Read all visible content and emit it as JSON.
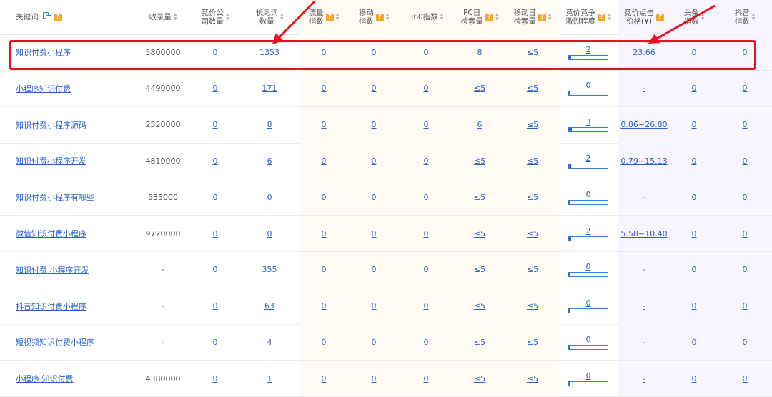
{
  "headers": {
    "keyword": "关键词",
    "index_volume": "收录量",
    "bid_companies": [
      "竞价公",
      "司数量"
    ],
    "long_tail": [
      "长尾词",
      "数量"
    ],
    "traffic_index": [
      "流量",
      "指数"
    ],
    "mobile_index": [
      "移动",
      "指数"
    ],
    "index_360": "360指数",
    "pc_daily": [
      "PC日",
      "检索量"
    ],
    "mobile_daily": [
      "移动日",
      "检索量"
    ],
    "bid_competition": [
      "竞价竞争",
      "激烈程度"
    ],
    "bid_click_price": [
      "竞价点击",
      "价格(¥)"
    ],
    "toutiao_index": [
      "头条",
      "指数"
    ],
    "douyin_index": [
      "抖音",
      "指数"
    ]
  },
  "icons": {
    "help": "?",
    "sort_up": "▲",
    "sort_down": "▼"
  },
  "colors": {
    "link": "#2a62c9",
    "highlight": "#e8111f",
    "help_badge": "#f5a623"
  },
  "rows": [
    {
      "keyword": "知识付费小程序",
      "index_volume": "5800000",
      "bid_companies": "0",
      "long_tail": "1353",
      "traffic_index": "0",
      "mobile_index": "0",
      "index_360": "0",
      "pc_daily": "8",
      "mobile_daily": "≤5",
      "competition": "2",
      "competition_level": 0.06,
      "price": "23.66",
      "toutiao": "0",
      "douyin": "0"
    },
    {
      "keyword": "小程序知识付费",
      "index_volume": "4490000",
      "bid_companies": "0",
      "long_tail": "171",
      "traffic_index": "0",
      "mobile_index": "0",
      "index_360": "0",
      "pc_daily": "≤5",
      "mobile_daily": "≤5",
      "competition": "0",
      "competition_level": 0.0,
      "price": "-",
      "toutiao": "0",
      "douyin": "0"
    },
    {
      "keyword": "知识付费小程序源码",
      "index_volume": "2520000",
      "bid_companies": "0",
      "long_tail": "8",
      "traffic_index": "0",
      "mobile_index": "0",
      "index_360": "0",
      "pc_daily": "6",
      "mobile_daily": "≤5",
      "competition": "3",
      "competition_level": 0.08,
      "price": "0.86~26.80",
      "toutiao": "0",
      "douyin": "0"
    },
    {
      "keyword": "知识付费小程序开发",
      "index_volume": "4810000",
      "bid_companies": "0",
      "long_tail": "6",
      "traffic_index": "0",
      "mobile_index": "0",
      "index_360": "0",
      "pc_daily": "≤5",
      "mobile_daily": "≤5",
      "competition": "2",
      "competition_level": 0.06,
      "price": "0.79~15.13",
      "toutiao": "0",
      "douyin": "0"
    },
    {
      "keyword": "知识付费小程序有哪些",
      "index_volume": "535000",
      "bid_companies": "0",
      "long_tail": "0",
      "traffic_index": "0",
      "mobile_index": "0",
      "index_360": "0",
      "pc_daily": "≤5",
      "mobile_daily": "≤5",
      "competition": "0",
      "competition_level": 0.0,
      "price": "-",
      "toutiao": "0",
      "douyin": "0"
    },
    {
      "keyword": "微信知识付费小程序",
      "index_volume": "9720000",
      "bid_companies": "0",
      "long_tail": "0",
      "traffic_index": "0",
      "mobile_index": "0",
      "index_360": "0",
      "pc_daily": "≤5",
      "mobile_daily": "≤5",
      "competition": "2",
      "competition_level": 0.06,
      "price": "5.58~10.40",
      "toutiao": "0",
      "douyin": "0"
    },
    {
      "keyword": "知识付费 小程序开发",
      "index_volume": "-",
      "bid_companies": "0",
      "long_tail": "355",
      "traffic_index": "0",
      "mobile_index": "0",
      "index_360": "0",
      "pc_daily": "≤5",
      "mobile_daily": "≤5",
      "competition": "0",
      "competition_level": 0.0,
      "price": "-",
      "toutiao": "0",
      "douyin": "0"
    },
    {
      "keyword": "抖音知识付费小程序",
      "index_volume": "-",
      "bid_companies": "0",
      "long_tail": "63",
      "traffic_index": "0",
      "mobile_index": "0",
      "index_360": "0",
      "pc_daily": "≤5",
      "mobile_daily": "≤5",
      "competition": "0",
      "competition_level": 0.0,
      "price": "-",
      "toutiao": "0",
      "douyin": "0"
    },
    {
      "keyword": "短视频知识付费小程序",
      "index_volume": "-",
      "bid_companies": "0",
      "long_tail": "4",
      "traffic_index": "0",
      "mobile_index": "0",
      "index_360": "0",
      "pc_daily": "≤5",
      "mobile_daily": "≤5",
      "competition": "0",
      "competition_level": 0.0,
      "price": "-",
      "toutiao": "0",
      "douyin": "0"
    },
    {
      "keyword": "小程序 知识付费",
      "index_volume": "4380000",
      "bid_companies": "0",
      "long_tail": "1",
      "traffic_index": "0",
      "mobile_index": "0",
      "index_360": "0",
      "pc_daily": "≤5",
      "mobile_daily": "≤5",
      "competition": "0",
      "competition_level": 0.0,
      "price": "-",
      "toutiao": "0",
      "douyin": "0"
    }
  ]
}
